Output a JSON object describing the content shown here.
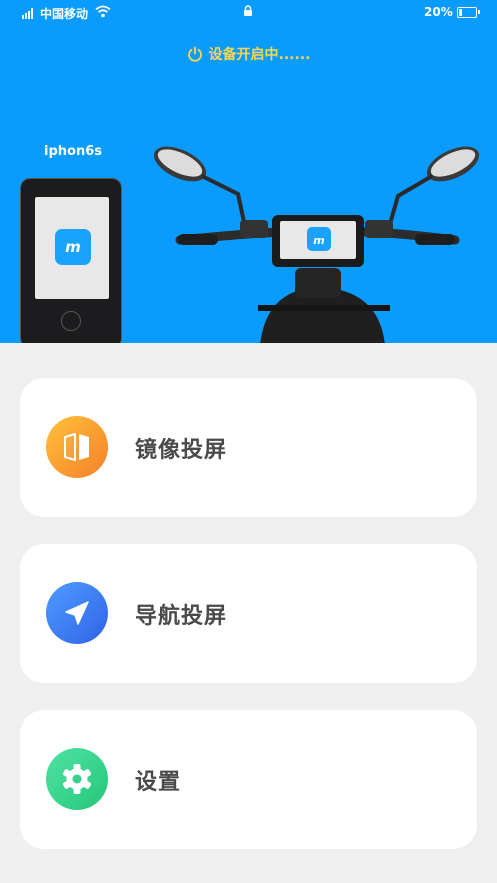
{
  "status_bar": {
    "carrier": "中国移动",
    "battery_percent": "20%",
    "battery_level": 0.2
  },
  "device_status": "设备开启中......",
  "phone_label": "iphon6s",
  "app_logo": "m",
  "menu": {
    "items": [
      {
        "label": "镜像投屏",
        "icon": "mirror-icon",
        "color_from": "#ffc23a",
        "color_to": "#f57f2a"
      },
      {
        "label": "导航投屏",
        "icon": "navigation-arrow-icon",
        "color_from": "#4f9cff",
        "color_to": "#2e63e8"
      },
      {
        "label": "设置",
        "icon": "gear-icon",
        "color_from": "#4fe3a4",
        "color_to": "#25c678"
      }
    ]
  },
  "colors": {
    "header_bg": "#0a9bff",
    "status_text": "#ffd84a",
    "page_bg": "#efefef"
  }
}
